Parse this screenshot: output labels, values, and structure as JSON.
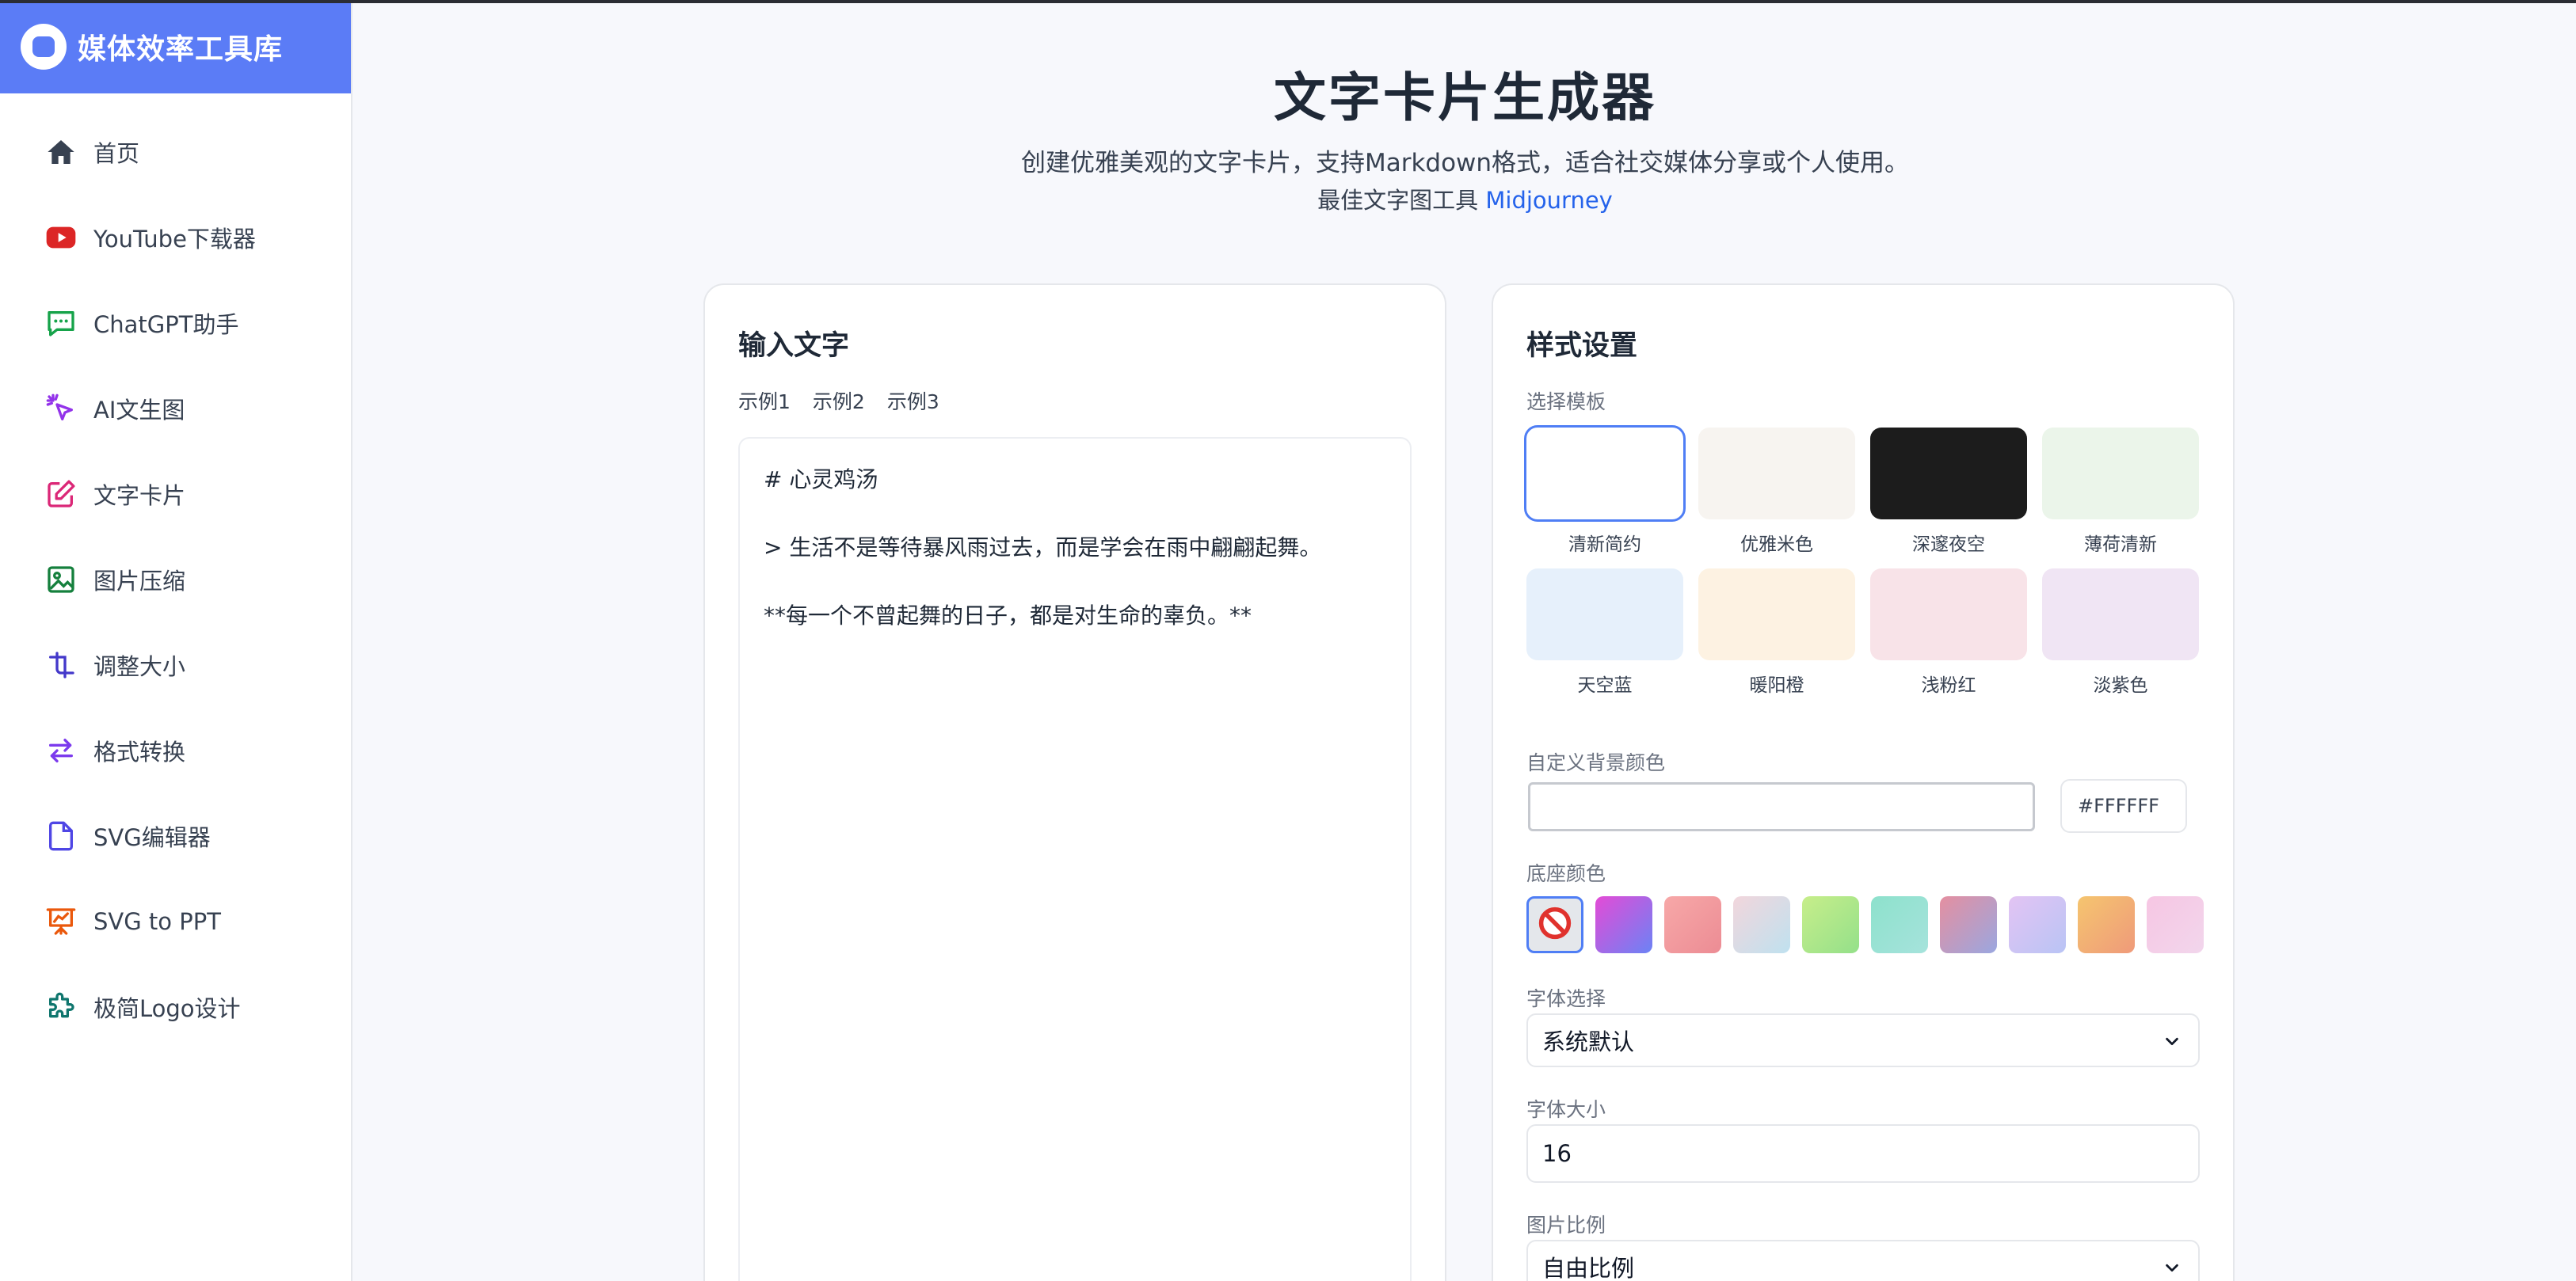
{
  "brand": {
    "title": "媒体效率工具库"
  },
  "sidebar": {
    "items": [
      {
        "label": "首页",
        "icon": "home-icon",
        "color": "#374151"
      },
      {
        "label": "YouTube下载器",
        "icon": "youtube-icon",
        "color": "#dc2626"
      },
      {
        "label": "ChatGPT助手",
        "icon": "chat-bubble-icon",
        "color": "#16a34a"
      },
      {
        "label": "AI文生图",
        "icon": "magic-cursor-icon",
        "color": "#9333ea"
      },
      {
        "label": "文字卡片",
        "icon": "edit-icon",
        "color": "#db2777"
      },
      {
        "label": "图片压缩",
        "icon": "image-icon",
        "color": "#15803d"
      },
      {
        "label": "调整大小",
        "icon": "resize-icon",
        "color": "#4338ca"
      },
      {
        "label": "格式转换",
        "icon": "swap-icon",
        "color": "#7c3aed"
      },
      {
        "label": "SVG编辑器",
        "icon": "file-icon",
        "color": "#4f46e5"
      },
      {
        "label": "SVG to PPT",
        "icon": "presentation-icon",
        "color": "#ea580c"
      },
      {
        "label": "极简Logo设计",
        "icon": "puzzle-icon",
        "color": "#0f766e"
      }
    ]
  },
  "header": {
    "title": "文字卡片生成器",
    "subtitle": "创建优雅美观的文字卡片，支持Markdown格式，适合社交媒体分享或个人使用。",
    "subtitle2_prefix": "最佳文字图工具 ",
    "subtitle2_link": "Midjourney"
  },
  "input_card": {
    "title": "输入文字",
    "examples": [
      "示例1",
      "示例2",
      "示例3"
    ],
    "text": "# 心灵鸡汤\n\n> 生活不是等待暴风雨过去，而是学会在雨中翩翩起舞。\n\n**每一个不曾起舞的日子，都是对生命的辜负。**"
  },
  "style_card": {
    "title": "样式设置",
    "template_label": "选择模板",
    "templates": [
      {
        "name": "清新简约",
        "color": "#ffffff",
        "selected": true
      },
      {
        "name": "优雅米色",
        "color": "#f7f4f0"
      },
      {
        "name": "深邃夜空",
        "color": "#1c1c1c"
      },
      {
        "name": "薄荷清新",
        "color": "#ebf5ea"
      },
      {
        "name": "天空蓝",
        "color": "#e6f0fb"
      },
      {
        "name": "暖阳橙",
        "color": "#fdf2e2"
      },
      {
        "name": "浅粉红",
        "color": "#f8e3e8"
      },
      {
        "name": "淡紫色",
        "color": "#f0e5f4"
      }
    ],
    "bg_color_label": "自定义背景颜色",
    "bg_color_value": "#FFFFFF",
    "base_color_label": "底座颜色",
    "base_swatches": [
      "none",
      "linear-gradient(135deg,#e44bd6,#6b83f5)",
      "linear-gradient(135deg,#f7a8a8,#ec8c94)",
      "linear-gradient(135deg,#f2d6dc,#bfe1ef)",
      "linear-gradient(135deg,#c7ee8a,#94e08a)",
      "linear-gradient(135deg,#8de1cc,#a6e3dc)",
      "linear-gradient(135deg,#e58fa0,#9aa7e0)",
      "linear-gradient(135deg,#e3c4f3,#b9c4f5)",
      "linear-gradient(135deg,#f5c56f,#ef9a7a)",
      "linear-gradient(135deg,#f6c6e3,#f2d6ec)"
    ],
    "font_label": "字体选择",
    "font_value": "系统默认",
    "size_label": "字体大小",
    "size_value": "16",
    "ratio_label": "图片比例",
    "ratio_value": "自由比例"
  }
}
